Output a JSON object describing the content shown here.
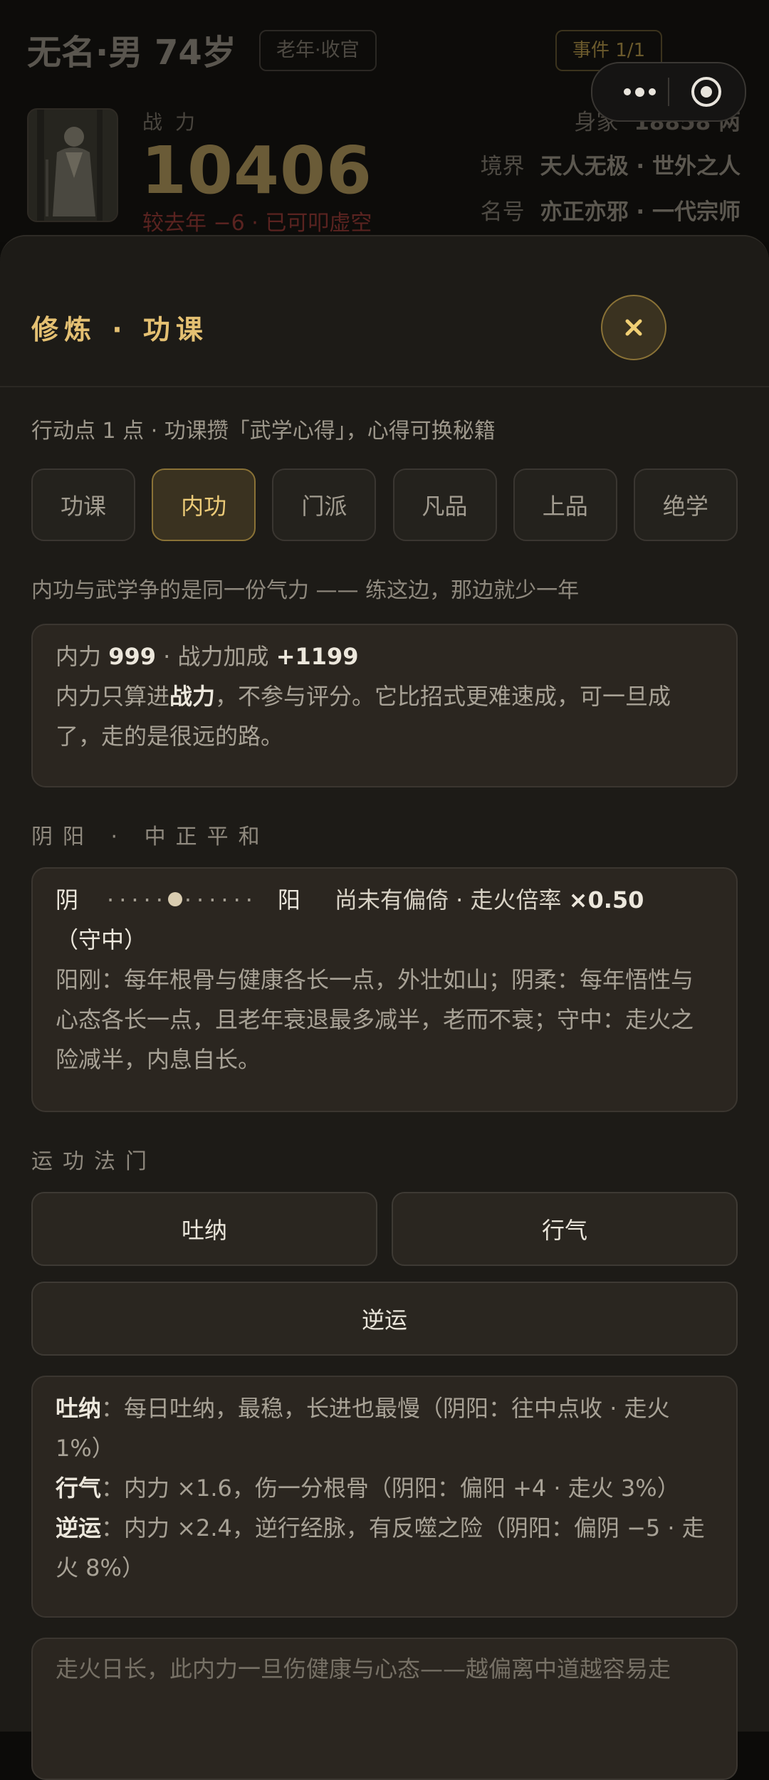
{
  "header": {
    "name": "无名·男 74岁",
    "stage_badge": "老年·收官",
    "event_badge": "事件 1/1",
    "zhanli_label": "战力",
    "zhanli_value": "10406",
    "zhanli_change": "较去年 −6 · 已可叩虚空",
    "wealth_label": "身家",
    "wealth_value": "18858 两",
    "realm_label": "境界",
    "realm_value": "天人无极 · 世外之人",
    "title_label": "名号",
    "title_value": "亦正亦邪 · 一代宗师"
  },
  "capsule": {
    "more_icon": "more-dots-icon",
    "close_icon": "mini-program-close-icon"
  },
  "sheet": {
    "title": "修炼 · 功课",
    "close_icon": "close-x-icon",
    "intro": "行动点 1 点 · 功课攒「武学心得」，心得可换秘籍",
    "tabs": [
      {
        "label": "功课",
        "active": false
      },
      {
        "label": "内功",
        "active": true
      },
      {
        "label": "门派",
        "active": false
      },
      {
        "label": "凡品",
        "active": false
      },
      {
        "label": "上品",
        "active": false
      },
      {
        "label": "绝学",
        "active": false
      }
    ],
    "note": "内功与武学争的是同一份气力 —— 练这边，那边就少一年",
    "neili": {
      "label": "内力",
      "value": "999",
      "sep": "·",
      "bonus_label": "战力加成",
      "bonus_value": "+1199",
      "desc_prefix": "内力只算进",
      "desc_bold": "战力",
      "desc_suffix": "，不参与评分。它比招式更难速成，可一旦成了，走的是很远的路。"
    },
    "yinyang_section": "阴阳 · 中正平和",
    "yinyang": {
      "yin": "阴",
      "yang": "阳",
      "scale_left": "·····",
      "scale_right": "······",
      "position": 0.5,
      "status_prefix": "尚未有偏倚 · 走火倍率",
      "multiplier": "×0.50",
      "mode": "（守中）",
      "desc": "阳刚：每年根骨与健康各长一点，外壮如山；阴柔：每年悟性与心态各长一点，且老年衰退最多减半，老而不衰；守中：走火之险减半，内息自长。"
    },
    "methods_section": "运功法门",
    "methods": [
      "吐纳",
      "行气",
      "逆运"
    ],
    "method_desc": [
      {
        "name": "吐纳",
        "text": "：每日吐纳，最稳，长进也最慢（阴阳：往中点收 · 走火 1%）"
      },
      {
        "name": "行气",
        "text": "：内力 ×1.6，伤一分根骨（阴阳：偏阳 +4 · 走火 3%）"
      },
      {
        "name": "逆运",
        "text": "：内力 ×2.4，逆行经脉，有反噬之险（阴阳：偏阴 −5 · 走火 8%）"
      }
    ],
    "partial_card": "走火日长，此内力一旦伤健康与心态——越偏离中道越容易走"
  }
}
